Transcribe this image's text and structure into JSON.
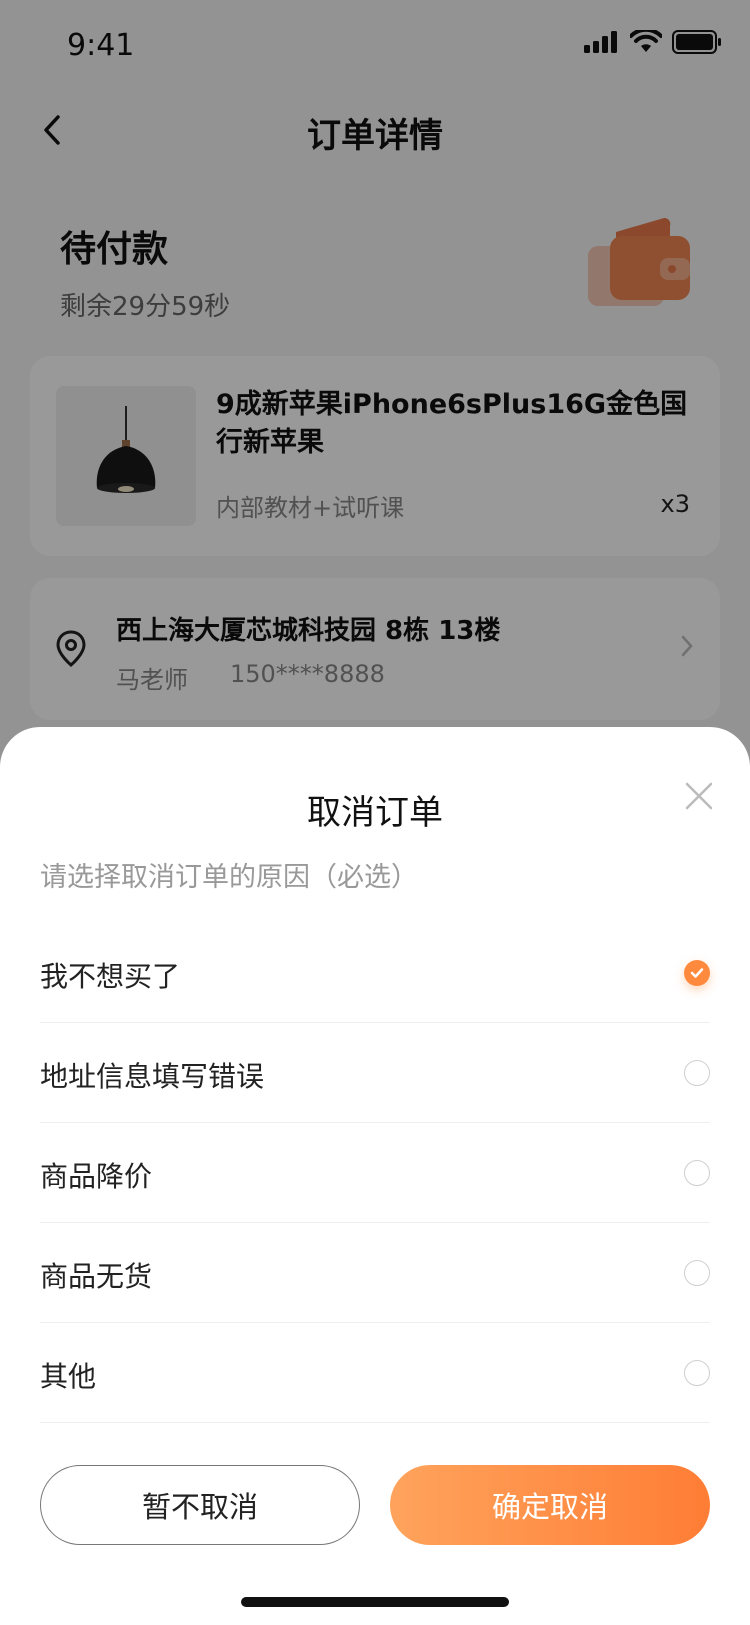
{
  "status_bar": {
    "time": "9:41"
  },
  "nav": {
    "title": "订单详情"
  },
  "order": {
    "status": "待付款",
    "countdown": "剩余29分59秒"
  },
  "product": {
    "name": "9成新苹果iPhone6sPlus16G金色国行新苹果",
    "spec": "内部教材+试听课",
    "qty": "x3"
  },
  "address": {
    "line": "西上海大厦芯城科技园 8栋 13楼",
    "name": "马老师",
    "phone": "150****8888"
  },
  "sheet": {
    "title": "取消订单",
    "hint": "请选择取消订单的原因（必选）",
    "reasons": [
      {
        "label": "我不想买了",
        "selected": true
      },
      {
        "label": "地址信息填写错误",
        "selected": false
      },
      {
        "label": "商品降价",
        "selected": false
      },
      {
        "label": "商品无货",
        "selected": false
      },
      {
        "label": "其他",
        "selected": false
      }
    ],
    "keep_label": "暂不取消",
    "confirm_label": "确定取消"
  },
  "colors": {
    "accent": "#ff8a3d",
    "accent_gradient_start": "#ffa35c",
    "accent_gradient_end": "#ff7d35"
  }
}
